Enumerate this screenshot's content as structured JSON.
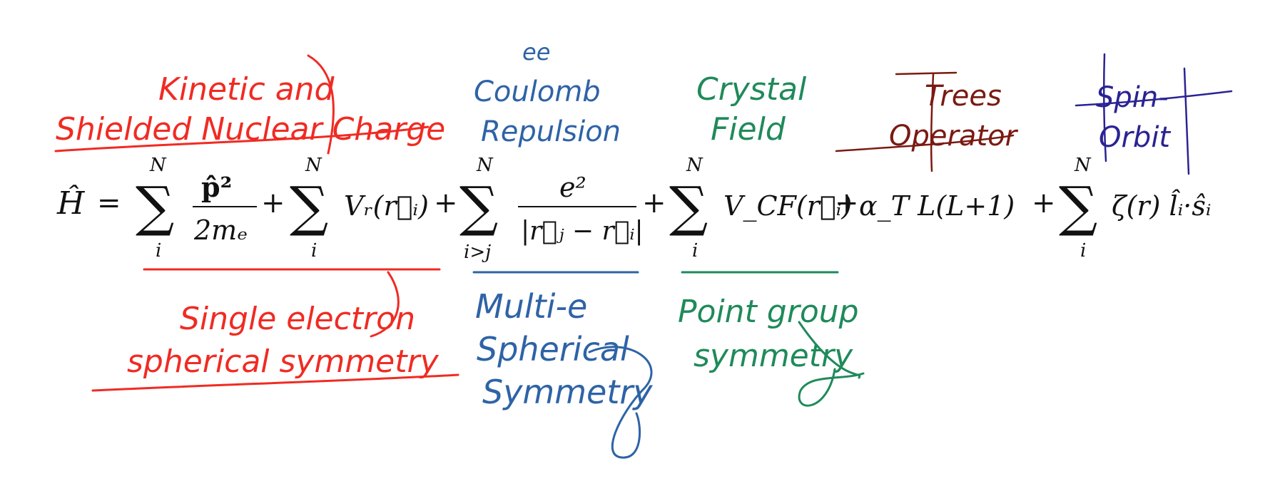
{
  "colors": {
    "red": "#f02b23",
    "blue": "#2e63a6",
    "green": "#1f8a5a",
    "maroon": "#7a1a12",
    "navy": "#2a2393",
    "ink": "#111111"
  },
  "annotations_top": {
    "kinetic_line1": "Kinetic and",
    "kinetic_line2": "Shielded Nuclear Charge",
    "ee_line0": "ee",
    "ee_line1": "Coulomb",
    "ee_line2": "Repulsion",
    "crystal_line1": "Crystal",
    "crystal_line2": "Field",
    "trees_line1": "Trees",
    "trees_line2": "Operator",
    "spin_line1": "Spin-",
    "spin_line2": "Orbit"
  },
  "annotations_bottom": {
    "single_line1": "Single electron",
    "single_line2": "spherical symmetry",
    "multi_line1": "Multi-e",
    "multi_line2": "Spherical",
    "multi_line3": "Symmetry",
    "point_line1": "Point group",
    "point_line2": "symmetry"
  },
  "equation": {
    "lhs": "Ĥ",
    "equals": "=",
    "plus": "+",
    "sum": "∑",
    "upper_limit": "N",
    "lower_i": "i",
    "lower_igtj": "i>j",
    "kinetic_num": "p̂²",
    "kinetic_den": "2mₑ",
    "vr_term": "Vᵣ(r⃗ᵢ)",
    "coulomb_num": "e²",
    "coulomb_den": "|r⃗ⱼ − r⃗ᵢ|",
    "vcf_term": "V_CF(r⃗ᵢ)",
    "trees_term": "α_T L(L+1)",
    "spin_orbit_term": "ζ(r) l̂ᵢ·ŝᵢ"
  }
}
